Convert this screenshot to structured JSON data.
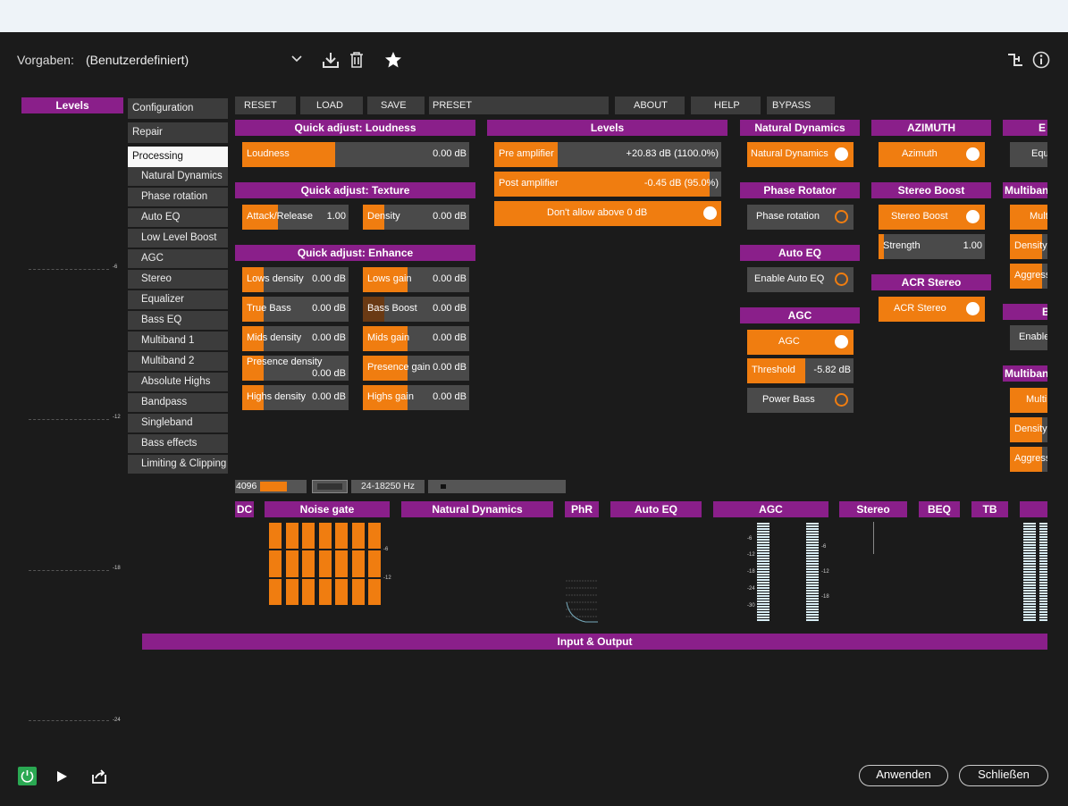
{
  "header": {
    "presets_label": "Vorgaben:",
    "preset_value": "(Benutzerdefiniert)"
  },
  "levels_side": {
    "title": "Levels",
    "scale": [
      "-6",
      "-12",
      "-18",
      "-24"
    ]
  },
  "nav": {
    "configuration": "Configuration",
    "repair": "Repair",
    "processing": "Processing",
    "items": [
      "Natural Dynamics",
      "Phase rotation",
      "Auto EQ",
      "Low Level Boost",
      "AGC",
      "Stereo",
      "Equalizer",
      "Bass EQ",
      "Multiband 1",
      "Multiband 2",
      "Absolute Highs",
      "Bandpass",
      "Singleband",
      "Bass effects",
      "Limiting & Clipping"
    ]
  },
  "toolbar": {
    "reset": "RESET",
    "load": "LOAD",
    "save": "SAVE",
    "preset": "PRESET",
    "about": "ABOUT",
    "help": "HELP",
    "bypass": "BYPASS"
  },
  "loudness": {
    "title": "Quick adjust: Loudness",
    "label": "Loudness",
    "value": "0.00 dB",
    "fill": 0.41
  },
  "texture": {
    "title": "Quick adjust: Texture",
    "attack": {
      "label": "Attack/Release",
      "value": "1.00",
      "fill": 0.34
    },
    "density": {
      "label": "Density",
      "value": "0.00 dB",
      "fill": 0.2
    }
  },
  "enhance": {
    "title": "Quick adjust: Enhance",
    "items": [
      {
        "label": "Lows density",
        "value": "0.00 dB",
        "fill": 0.2
      },
      {
        "label": "Lows gain",
        "value": "0.00 dB",
        "fill": 0.42
      },
      {
        "label": "True Bass",
        "value": "0.00 dB",
        "fill": 0.2
      },
      {
        "label": "Bass Boost",
        "value": "0.00 dB",
        "fill": 0.2,
        "dim": true
      },
      {
        "label": "Mids density",
        "value": "0.00 dB",
        "fill": 0.2
      },
      {
        "label": "Mids gain",
        "value": "0.00 dB",
        "fill": 0.42
      },
      {
        "label": "Presence density",
        "value": "0.00 dB",
        "fill": 0.2
      },
      {
        "label": "Presence gain",
        "value": "0.00 dB",
        "fill": 0.42
      },
      {
        "label": "Highs density",
        "value": "0.00 dB",
        "fill": 0.2
      },
      {
        "label": "Highs gain",
        "value": "0.00 dB",
        "fill": 0.42
      }
    ]
  },
  "levels": {
    "title": "Levels",
    "pre": {
      "label": "Pre amplifier",
      "value": "+20.83 dB (1100.0%)",
      "fill": 0.28
    },
    "post": {
      "label": "Post amplifier",
      "value": "-0.45 dB (95.0%)",
      "fill": 0.95
    },
    "dont_allow": "Don't allow above 0 dB"
  },
  "natural_dynamics": {
    "title": "Natural Dynamics",
    "toggle": "Natural Dynamics"
  },
  "phase_rotator": {
    "title": "Phase Rotator",
    "toggle": "Phase rotation"
  },
  "auto_eq": {
    "title": "Auto EQ",
    "toggle": "Enable Auto EQ"
  },
  "agc": {
    "title": "AGC",
    "toggle": "AGC",
    "threshold": {
      "label": "Threshold",
      "value": "-5.82 dB",
      "fill": 0.55
    },
    "power_bass": "Power Bass"
  },
  "azimuth": {
    "title": "AZIMUTH",
    "toggle": "Azimuth"
  },
  "stereo_boost": {
    "title": "Stereo Boost",
    "toggle": "Stereo Boost",
    "strength": {
      "label": "Strength",
      "value": "1.00",
      "fill": 0.05
    }
  },
  "acr_stereo": {
    "title": "ACR Stereo",
    "toggle": "ACR Stereo"
  },
  "col_cut": {
    "eq_title": "E",
    "eq_item": "Equ",
    "mb_title": "Multiban",
    "mb_items": [
      "Mult",
      "Density",
      "Aggress"
    ],
    "b_title": "B",
    "b_item": "Enable",
    "mb2_title": "Multiban",
    "mb2_items": [
      "Multi",
      "Density",
      "Aggress"
    ]
  },
  "status": {
    "fft": "4096",
    "range": "24-18250 Hz"
  },
  "meters": {
    "dc": "DC",
    "noise_gate": "Noise gate",
    "natural_dynamics": "Natural Dynamics",
    "phr": "PhR",
    "auto_eq": "Auto EQ",
    "agc": "AGC",
    "stereo": "Stereo",
    "beq": "BEQ",
    "tb": "TB",
    "ng_scale": [
      "-6",
      "-12"
    ],
    "agc_scale_left": [
      "-6",
      "-12",
      "-18",
      "-24",
      "-30"
    ],
    "agc_scale_right": [
      "-6",
      "-12",
      "-18"
    ]
  },
  "io": {
    "title": "Input & Output"
  },
  "footer": {
    "apply": "Anwenden",
    "close": "Schließen"
  }
}
